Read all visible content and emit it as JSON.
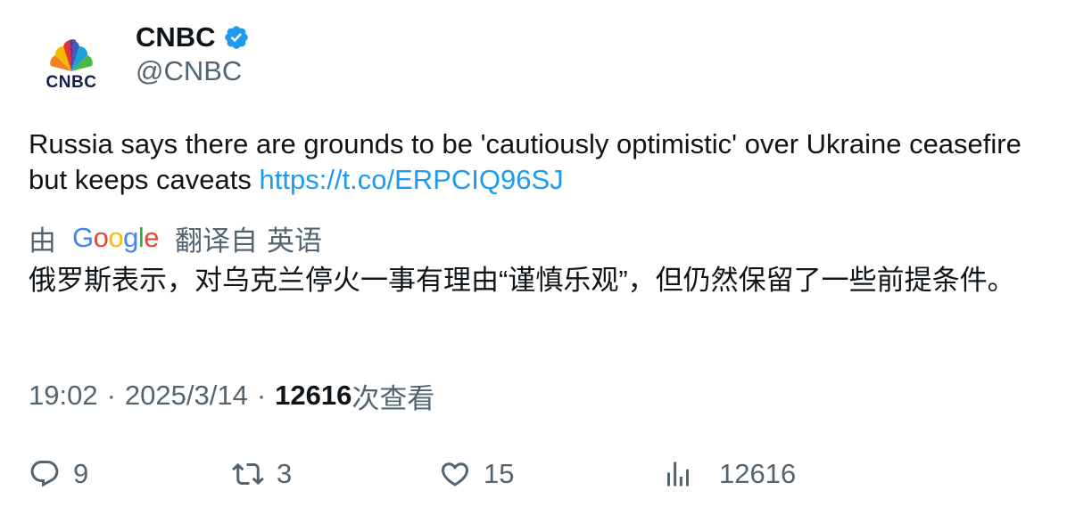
{
  "author": {
    "display_name": "CNBC",
    "handle": "@CNBC",
    "avatar_text": "CNBC",
    "verified": true,
    "verified_color": "#1d9bf0"
  },
  "tweet": {
    "text": "Russia says there are grounds to be 'cautiously optimistic' over Ukraine ceasefire but keeps caveats ",
    "link": "https://t.co/ERPCIQ96SJ",
    "link_color": "#1d9bf0"
  },
  "translation": {
    "by_label": "由",
    "provider_letters": [
      "G",
      "o",
      "o",
      "g",
      "l",
      "e"
    ],
    "translated_from_label": "翻译自",
    "source_language": "英语",
    "text": "俄罗斯表示，对乌克兰停火一事有理由“谨慎乐观”，但仍然保留了一些前提条件。"
  },
  "meta": {
    "time": "19:02",
    "separator": "·",
    "date": "2025/3/14",
    "views_count": "12616",
    "views_label": "次查看"
  },
  "actions": {
    "reply_count": "9",
    "retweet_count": "3",
    "like_count": "15",
    "views_count": "12616",
    "icons": [
      "reply-icon",
      "retweet-icon",
      "like-icon",
      "views-icon"
    ]
  },
  "colors": {
    "text_primary": "#0f1419",
    "text_secondary": "#536471",
    "accent": "#1d9bf0"
  }
}
